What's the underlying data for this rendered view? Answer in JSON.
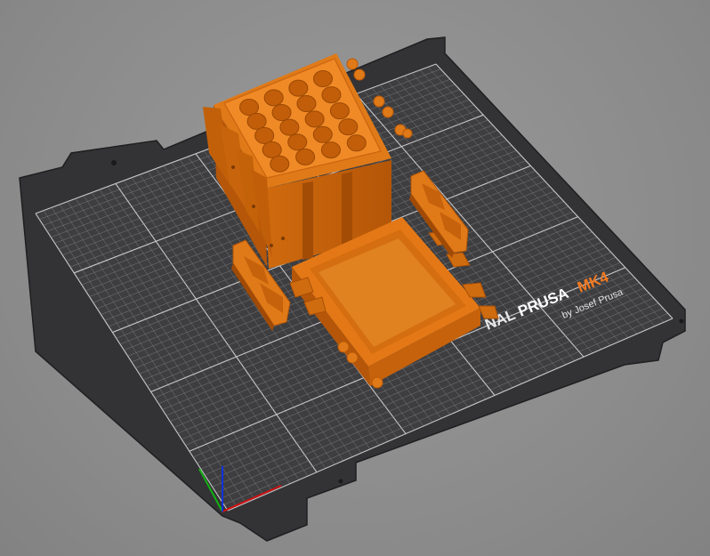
{
  "viewport": {
    "background_color": "#8c8c8c"
  },
  "print_bed": {
    "model": "MK4",
    "sheet_color": "#3a3a3c",
    "grid_color": "#7a7a7c",
    "brand": {
      "prefix": "NAL",
      "name": "PRUSA",
      "model": "MK4",
      "byline": "by Josef Prusa",
      "accent_color": "#f47a20",
      "text_color": "#e8e8e8"
    }
  },
  "objects": {
    "filament_color": "#e87a14",
    "items": [
      {
        "name": "Cell holder box with 20 sockets"
      },
      {
        "name": "Battery box lid tray"
      },
      {
        "name": "Hinge clip left"
      },
      {
        "name": "Hinge clip right"
      }
    ]
  },
  "axes": {
    "x_color": "#d01010",
    "y_color": "#10b010",
    "z_color": "#1030e0"
  }
}
